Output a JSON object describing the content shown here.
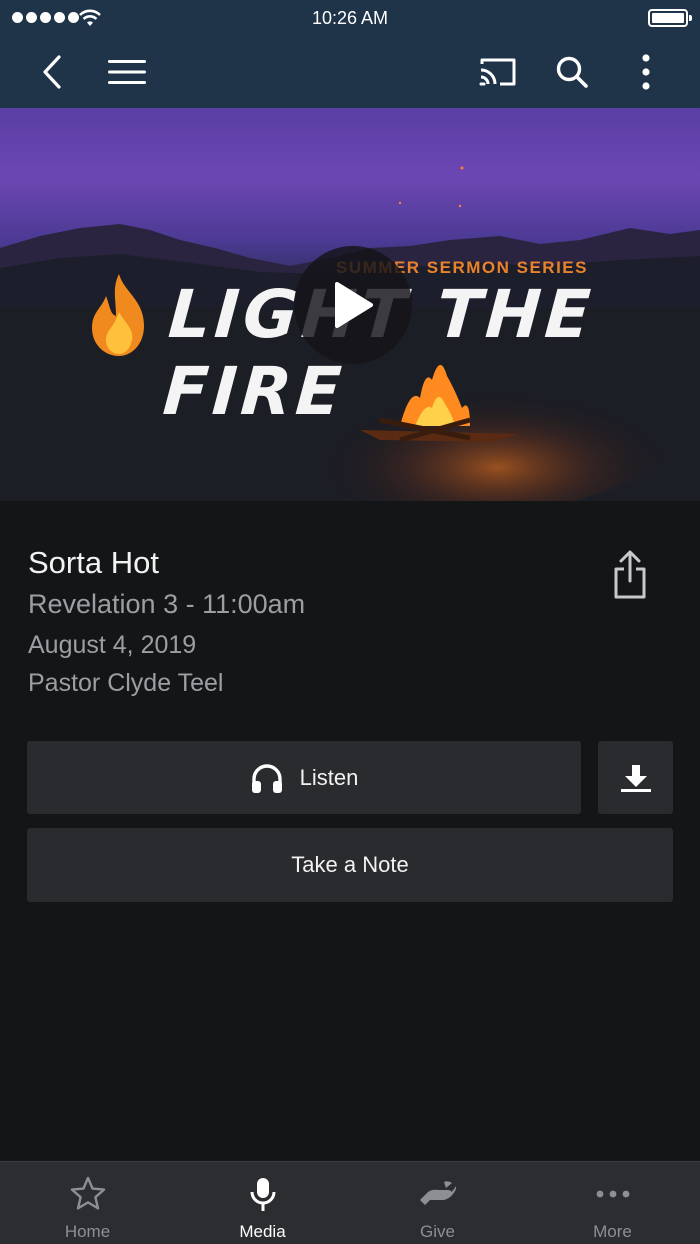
{
  "status_bar": {
    "time": "10:26 AM"
  },
  "nav": {
    "back_icon": "chevron-left-icon",
    "menu_icon": "hamburger-menu-icon",
    "cast_icon": "cast-icon",
    "search_icon": "search-icon",
    "more_icon": "vertical-ellipsis-icon"
  },
  "hero": {
    "series_label": "SUMMER SERMON SERIES",
    "artwork_title": "LIGHT THE FIRE",
    "play_icon": "play-icon"
  },
  "sermon": {
    "title": "Sorta Hot",
    "subtitle": "Revelation 3 - 11:00am",
    "date": "August 4, 2019",
    "speaker": "Pastor Clyde Teel",
    "share_icon": "share-icon"
  },
  "actions": {
    "listen_label": "Listen",
    "listen_icon": "headphones-icon",
    "download_icon": "download-icon",
    "note_label": "Take a Note"
  },
  "tabs": [
    {
      "label": "Home",
      "icon": "star-icon",
      "active": false
    },
    {
      "label": "Media",
      "icon": "microphone-icon",
      "active": true
    },
    {
      "label": "Give",
      "icon": "giving-hand-icon",
      "active": false
    },
    {
      "label": "More",
      "icon": "horizontal-ellipsis-icon",
      "active": false
    }
  ],
  "colors": {
    "nav_bg": "#1f3349",
    "page_bg": "#141517",
    "button_bg": "#2a2b2e",
    "tabbar_bg": "#2c2d30",
    "series_orange": "#e9822b",
    "muted_text": "#9b9ea3"
  }
}
